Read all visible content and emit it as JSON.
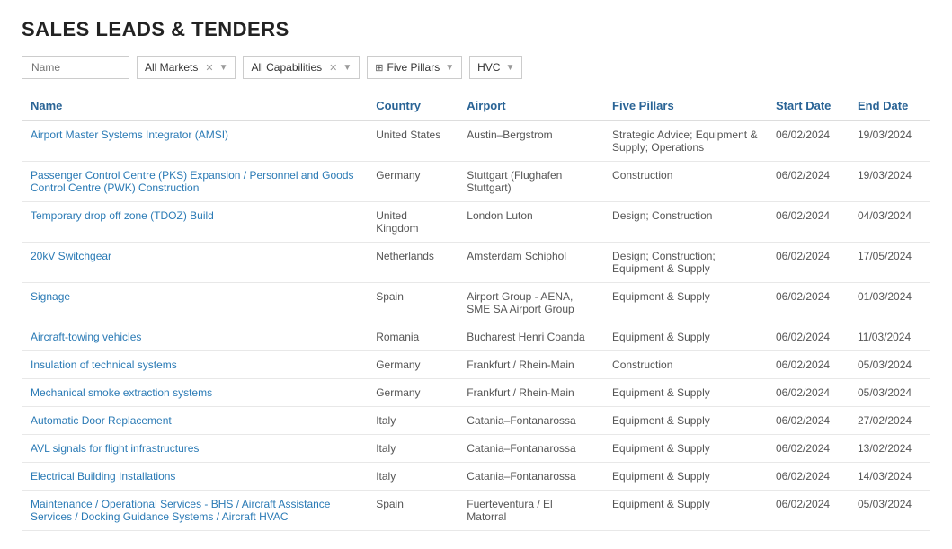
{
  "title": "SALES LEADS & TENDERS",
  "filters": {
    "name_placeholder": "Name",
    "market_label": "All Markets",
    "capabilities_label": "All Capabilities",
    "pillars_label": "Five Pillars",
    "hvc_label": "HVC"
  },
  "table": {
    "headers": [
      {
        "key": "name",
        "label": "Name"
      },
      {
        "key": "country",
        "label": "Country"
      },
      {
        "key": "airport",
        "label": "Airport"
      },
      {
        "key": "pillars",
        "label": "Five Pillars"
      },
      {
        "key": "start",
        "label": "Start Date"
      },
      {
        "key": "end",
        "label": "End Date"
      }
    ],
    "rows": [
      {
        "name": "Airport Master Systems Integrator (AMSI)",
        "country": "United States",
        "airport": "Austin–Bergstrom",
        "pillars": "Strategic Advice; Equipment & Supply; Operations",
        "start": "06/02/2024",
        "end": "19/03/2024"
      },
      {
        "name": "Passenger Control Centre (PKS) Expansion / Personnel and Goods Control Centre (PWK) Construction",
        "country": "Germany",
        "airport": "Stuttgart (Flughafen Stuttgart)",
        "pillars": "Construction",
        "start": "06/02/2024",
        "end": "19/03/2024"
      },
      {
        "name": "Temporary drop off zone (TDOZ) Build",
        "country": "United Kingdom",
        "airport": "London Luton",
        "pillars": "Design; Construction",
        "start": "06/02/2024",
        "end": "04/03/2024"
      },
      {
        "name": "20kV Switchgear",
        "country": "Netherlands",
        "airport": "Amsterdam Schiphol",
        "pillars": "Design; Construction; Equipment & Supply",
        "start": "06/02/2024",
        "end": "17/05/2024"
      },
      {
        "name": "Signage",
        "country": "Spain",
        "airport": "Airport Group - AENA, SME SA Airport Group",
        "pillars": "Equipment & Supply",
        "start": "06/02/2024",
        "end": "01/03/2024"
      },
      {
        "name": "Aircraft-towing vehicles",
        "country": "Romania",
        "airport": "Bucharest Henri Coanda",
        "pillars": "Equipment & Supply",
        "start": "06/02/2024",
        "end": "11/03/2024"
      },
      {
        "name": "Insulation of technical systems",
        "country": "Germany",
        "airport": "Frankfurt / Rhein-Main",
        "pillars": "Construction",
        "start": "06/02/2024",
        "end": "05/03/2024"
      },
      {
        "name": "Mechanical smoke extraction systems",
        "country": "Germany",
        "airport": "Frankfurt / Rhein-Main",
        "pillars": "Equipment & Supply",
        "start": "06/02/2024",
        "end": "05/03/2024"
      },
      {
        "name": "Automatic Door Replacement",
        "country": "Italy",
        "airport": "Catania–Fontanarossa",
        "pillars": "Equipment & Supply",
        "start": "06/02/2024",
        "end": "27/02/2024"
      },
      {
        "name": "AVL signals for flight infrastructures",
        "country": "Italy",
        "airport": "Catania–Fontanarossa",
        "pillars": "Equipment & Supply",
        "start": "06/02/2024",
        "end": "13/02/2024"
      },
      {
        "name": "Electrical Building Installations",
        "country": "Italy",
        "airport": "Catania–Fontanarossa",
        "pillars": "Equipment & Supply",
        "start": "06/02/2024",
        "end": "14/03/2024"
      },
      {
        "name": "Maintenance / Operational Services - BHS / Aircraft Assistance Services / Docking Guidance Systems / Aircraft HVAC",
        "country": "Spain",
        "airport": "Fuerteventura / El Matorral",
        "pillars": "Equipment & Supply",
        "start": "06/02/2024",
        "end": "05/03/2024"
      }
    ]
  }
}
